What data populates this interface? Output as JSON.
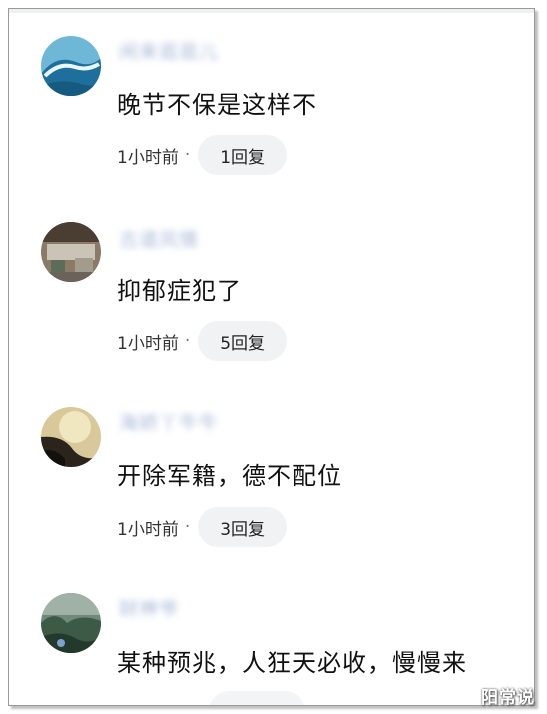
{
  "comments": [
    {
      "username": "闲来逛逛儿",
      "text": "晚节不保是这样不",
      "time": "1小时前",
      "separator": "·",
      "reply_label": "1回复",
      "avatar": "ocean-wave-avatar"
    },
    {
      "username": "古道风情",
      "text": "抑郁症犯了",
      "time": "1小时前",
      "separator": "·",
      "reply_label": "5回复",
      "avatar": "street-scene-avatar"
    },
    {
      "username": "海娇丫牛牛",
      "text": "开除军籍，德不配位",
      "time": "1小时前",
      "separator": "·",
      "reply_label": "3回复",
      "avatar": "portrait-avatar"
    },
    {
      "username": "财神爷",
      "text": "某种预兆，人狂天必收，慢慢来",
      "avatar": "landscape-avatar"
    }
  ],
  "watermark": "阳常说"
}
